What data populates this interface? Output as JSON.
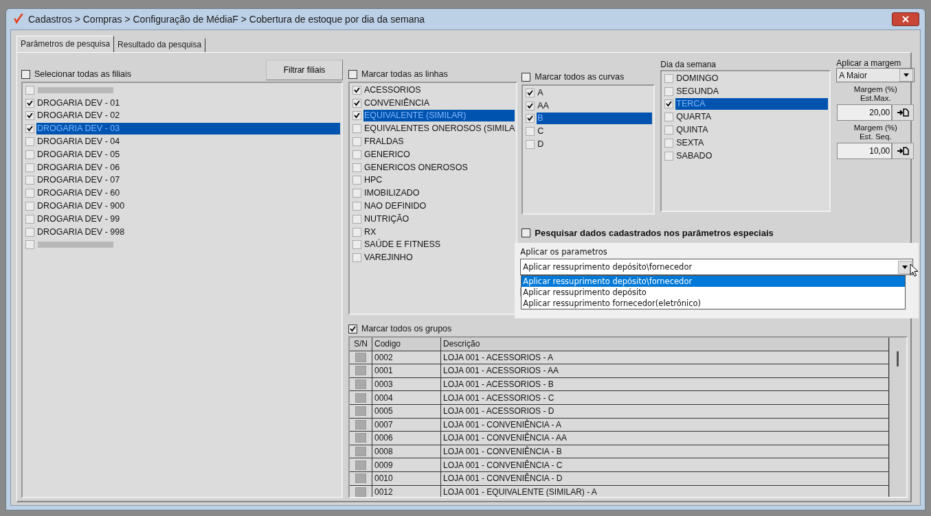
{
  "window": {
    "title": "Cadastros > Compras > Configuração de MédiaF > Cobertura de estoque por dia da semana"
  },
  "tabs": [
    {
      "label": "Parâmetros de pesquisa",
      "selected": true
    },
    {
      "label": "Resultado da pesquisa",
      "selected": false
    }
  ],
  "filiais": {
    "select_all": {
      "label": "Selecionar todas as filiais",
      "checked": false
    },
    "filter_button": "Filtrar filiais",
    "items": [
      {
        "kind": "redacted",
        "checked": false,
        "selected": false
      },
      {
        "kind": "text",
        "label": "DROGARIA DEV - 01",
        "checked": true,
        "selected": false
      },
      {
        "kind": "text",
        "label": "DROGARIA DEV - 02",
        "checked": true,
        "selected": false
      },
      {
        "kind": "text",
        "label": "DROGARIA DEV - 03",
        "checked": true,
        "selected": true
      },
      {
        "kind": "text",
        "label": "DROGARIA DEV - 04",
        "checked": false,
        "selected": false
      },
      {
        "kind": "text",
        "label": "DROGARIA DEV - 05",
        "checked": false,
        "selected": false
      },
      {
        "kind": "text",
        "label": "DROGARIA DEV - 06",
        "checked": false,
        "selected": false
      },
      {
        "kind": "text",
        "label": "DROGARIA DEV - 07",
        "checked": false,
        "selected": false
      },
      {
        "kind": "text",
        "label": "DROGARIA DEV - 60",
        "checked": false,
        "selected": false
      },
      {
        "kind": "text",
        "label": "DROGARIA DEV - 900",
        "checked": false,
        "selected": false
      },
      {
        "kind": "text",
        "label": "DROGARIA DEV - 99",
        "checked": false,
        "selected": false
      },
      {
        "kind": "text",
        "label": "DROGARIA DEV - 998",
        "checked": false,
        "selected": false
      },
      {
        "kind": "redacted",
        "checked": false,
        "selected": false
      }
    ]
  },
  "linhas": {
    "select_all": {
      "label": "Marcar todas as linhas",
      "checked": false
    },
    "items": [
      {
        "label": "ACESSORIOS",
        "checked": true,
        "selected": false
      },
      {
        "label": "CONVENIÊNCIA",
        "checked": true,
        "selected": false
      },
      {
        "label": "EQUIVALENTE (SIMILAR)",
        "checked": true,
        "selected": true
      },
      {
        "label": "EQUIVALENTES ONEROSOS (SIMILA",
        "checked": false,
        "selected": false
      },
      {
        "label": "FRALDAS",
        "checked": false,
        "selected": false
      },
      {
        "label": "GENERICO",
        "checked": false,
        "selected": false
      },
      {
        "label": "GENERICOS ONEROSOS",
        "checked": false,
        "selected": false
      },
      {
        "label": "HPC",
        "checked": false,
        "selected": false
      },
      {
        "label": "IMOBILIZADO",
        "checked": false,
        "selected": false
      },
      {
        "label": "NAO DEFINIDO",
        "checked": false,
        "selected": false
      },
      {
        "label": "NUTRIÇÃO",
        "checked": false,
        "selected": false
      },
      {
        "label": "RX",
        "checked": false,
        "selected": false
      },
      {
        "label": "SAÚDE E FITNESS",
        "checked": false,
        "selected": false
      },
      {
        "label": "VAREJINHO",
        "checked": false,
        "selected": false
      }
    ]
  },
  "curvas": {
    "select_all": {
      "label": "Marcar todos as curvas",
      "checked": false
    },
    "items": [
      {
        "label": "A",
        "checked": true,
        "selected": false
      },
      {
        "label": "AA",
        "checked": true,
        "selected": false
      },
      {
        "label": "B",
        "checked": true,
        "selected": true
      },
      {
        "label": "C",
        "checked": false,
        "selected": false
      },
      {
        "label": "D",
        "checked": false,
        "selected": false
      }
    ]
  },
  "dias": {
    "label": "Dia da semana",
    "items": [
      {
        "label": "DOMINGO",
        "checked": false,
        "selected": false
      },
      {
        "label": "SEGUNDA",
        "checked": false,
        "selected": false
      },
      {
        "label": "TERCA",
        "checked": true,
        "selected": true
      },
      {
        "label": "QUARTA",
        "checked": false,
        "selected": false
      },
      {
        "label": "QUINTA",
        "checked": false,
        "selected": false
      },
      {
        "label": "SEXTA",
        "checked": false,
        "selected": false
      },
      {
        "label": "SABADO",
        "checked": false,
        "selected": false
      }
    ]
  },
  "margem": {
    "label": "Aplicar a margem",
    "value": "A Maior",
    "fields": [
      {
        "label_1": "Margem (%)",
        "label_2": "Est.Max.",
        "value": "20,00"
      },
      {
        "label_1": "Margem (%)",
        "label_2": "Est. Seq.",
        "value": "10,00"
      }
    ]
  },
  "especiais": {
    "label": "Pesquisar dados cadastrados nos parâmetros especiais",
    "checked": false
  },
  "aplicar": {
    "label": "Aplicar os parametros",
    "value": "Aplicar ressuprimento depósito\\fornecedor",
    "options": [
      {
        "label": "Aplicar ressuprimento depósito\\fornecedor",
        "selected": true
      },
      {
        "label": "Aplicar ressuprimento depósito",
        "selected": false
      },
      {
        "label": "Aplicar ressuprimento fornecedor(eletrônico)",
        "selected": false
      }
    ]
  },
  "grupos": {
    "select_all": {
      "label": "Marcar todos os grupos",
      "checked": true
    },
    "columns": [
      "S/N",
      "Codigo",
      "Descrição"
    ],
    "rows": [
      {
        "code": "0002",
        "description": "LOJA 001 - ACESSORIOS - A"
      },
      {
        "code": "0001",
        "description": "LOJA 001 - ACESSORIOS - AA"
      },
      {
        "code": "0003",
        "description": "LOJA 001 - ACESSORIOS - B"
      },
      {
        "code": "0004",
        "description": "LOJA 001 - ACESSORIOS - C"
      },
      {
        "code": "0005",
        "description": "LOJA 001 - ACESSORIOS - D"
      },
      {
        "code": "0007",
        "description": "LOJA 001 - CONVENIÊNCIA - A"
      },
      {
        "code": "0006",
        "description": "LOJA 001 - CONVENIÊNCIA - AA"
      },
      {
        "code": "0008",
        "description": "LOJA 001 - CONVENIÊNCIA - B"
      },
      {
        "code": "0009",
        "description": "LOJA 001 - CONVENIÊNCIA - C"
      },
      {
        "code": "0010",
        "description": "LOJA 001 - CONVENIÊNCIA - D"
      },
      {
        "code": "0012",
        "description": "LOJA 001 - EQUIVALENTE (SIMILAR) - A"
      }
    ]
  }
}
